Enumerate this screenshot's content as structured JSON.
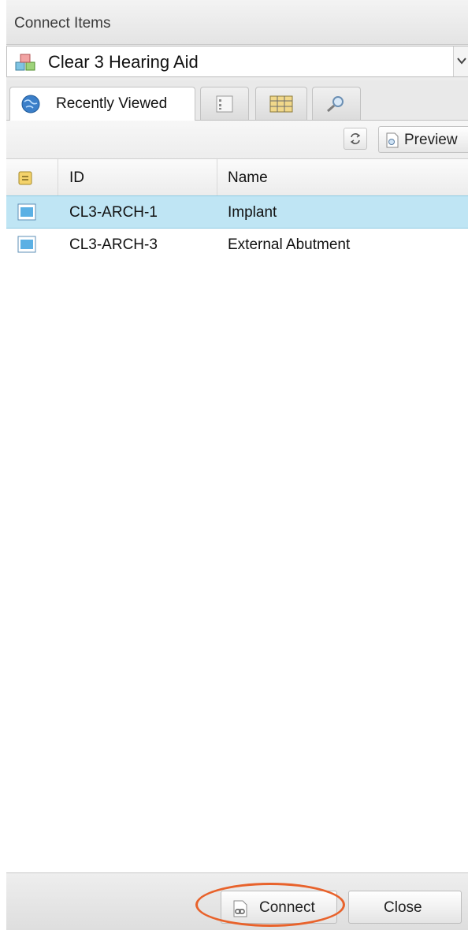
{
  "dialog": {
    "title": "Connect Items"
  },
  "project_select": {
    "value": "Clear 3 Hearing Aid",
    "icon": "project-icon"
  },
  "tabs": [
    {
      "label": "Recently Viewed",
      "icon": "globe-icon",
      "active": true
    },
    {
      "label": "",
      "icon": "tree-icon",
      "active": false
    },
    {
      "label": "",
      "icon": "grid-view-icon",
      "active": false
    },
    {
      "label": "",
      "icon": "search-icon",
      "active": false
    }
  ],
  "toolbar": {
    "refresh_icon": "refresh-icon",
    "preview_label": "Preview"
  },
  "table": {
    "columns": [
      "",
      "ID",
      "Name"
    ],
    "rows": [
      {
        "id": "CL3-ARCH-1",
        "name": "Implant",
        "selected": true
      },
      {
        "id": "CL3-ARCH-3",
        "name": "External Abutment",
        "selected": false
      }
    ]
  },
  "footer": {
    "connect_label": "Connect",
    "close_label": "Close"
  },
  "colors": {
    "selection": "#bfe5f4",
    "highlight_annotation": "#e8622b"
  }
}
